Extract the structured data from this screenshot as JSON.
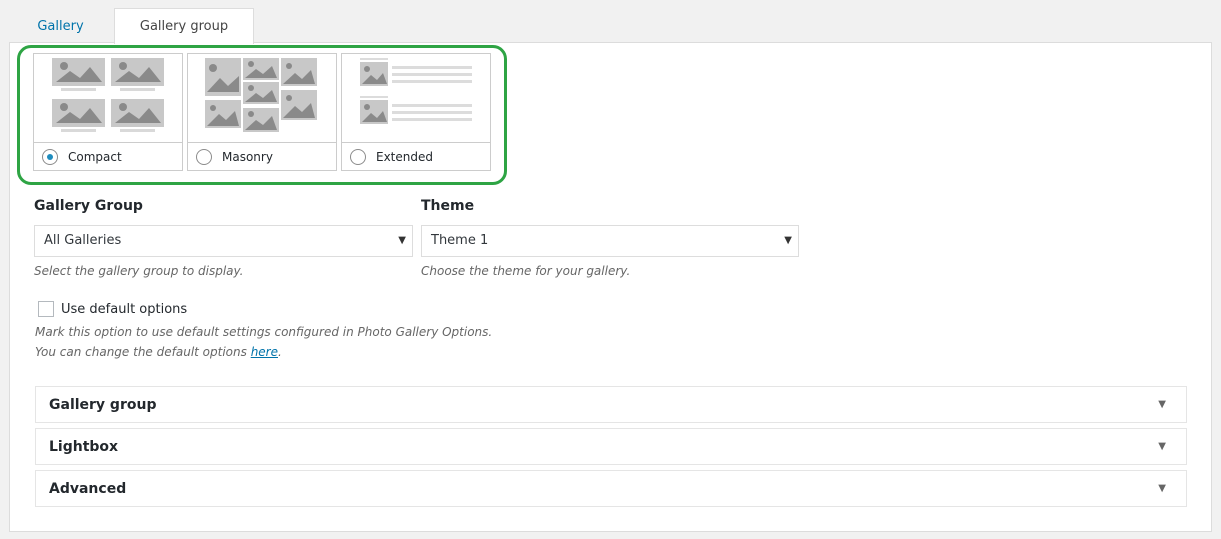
{
  "tabs": [
    {
      "label": "Gallery",
      "active": false
    },
    {
      "label": "Gallery group",
      "active": true
    }
  ],
  "views": [
    {
      "label": "Compact",
      "selected": true
    },
    {
      "label": "Masonry",
      "selected": false
    },
    {
      "label": "Extended",
      "selected": false
    }
  ],
  "gallery_group": {
    "title": "Gallery Group",
    "selected": "All Galleries",
    "description": "Select the gallery group to display."
  },
  "theme": {
    "title": "Theme",
    "selected": "Theme 1",
    "description": "Choose the theme for your gallery."
  },
  "default_options": {
    "label": "Use default options",
    "checked": false,
    "desc_line1": "Mark this option to use default settings configured in Photo Gallery Options.",
    "desc_line2_prefix": "You can change the default options ",
    "desc_link": "here",
    "desc_line2_suffix": "."
  },
  "sections": [
    {
      "title": "Gallery group"
    },
    {
      "title": "Lightbox"
    },
    {
      "title": "Advanced"
    }
  ],
  "colors": {
    "highlight": "#2ea444",
    "link": "#0073aa",
    "thumb": "#c8c8c8",
    "thumb_icon": "#8a8a8a"
  },
  "icons": {
    "dropdown": "caret-down-icon",
    "accordion": "triangle-down-icon"
  }
}
